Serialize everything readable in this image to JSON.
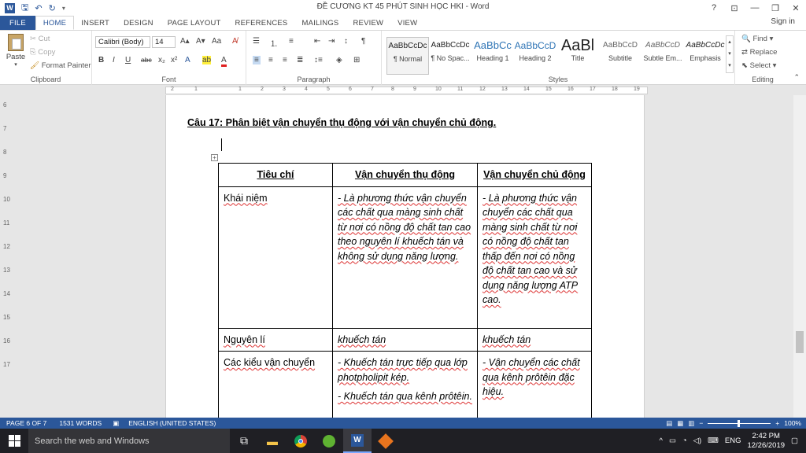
{
  "window": {
    "title": "ĐỀ CƯƠNG KT 45 PHÚT SINH HỌC HKI - Word",
    "controls": [
      "?",
      "⊡",
      "—",
      "❐",
      "✕"
    ]
  },
  "quick_access": {
    "app_icon": "W",
    "save_icon": "save-icon",
    "undo_icon": "undo-icon",
    "redo_icon": "redo-icon"
  },
  "tabs": [
    "FILE",
    "HOME",
    "INSERT",
    "DESIGN",
    "PAGE LAYOUT",
    "REFERENCES",
    "MAILINGS",
    "REVIEW",
    "VIEW"
  ],
  "active_tab": "HOME",
  "signin": "Sign in",
  "clipboard": {
    "paste": "Paste",
    "cut": "Cut",
    "copy": "Copy",
    "format_painter": "Format Painter",
    "label": "Clipboard"
  },
  "font": {
    "name": "Calibri (Body)",
    "size": "14",
    "label": "Font"
  },
  "paragraph": {
    "label": "Paragraph"
  },
  "styles": {
    "label": "Styles",
    "items": [
      {
        "preview": "AaBbCcDc",
        "name": "¶ Normal"
      },
      {
        "preview": "AaBbCcDc",
        "name": "¶ No Spac..."
      },
      {
        "preview": "AaBbCc",
        "name": "Heading 1"
      },
      {
        "preview": "AaBbCcD",
        "name": "Heading 2"
      },
      {
        "preview": "AaBl",
        "name": "Title"
      },
      {
        "preview": "AaBbCcD",
        "name": "Subtitle"
      },
      {
        "preview": "AaBbCcD",
        "name": "Subtle Em..."
      },
      {
        "preview": "AaBbCcDc",
        "name": "Emphasis"
      }
    ]
  },
  "editing": {
    "find": "Find",
    "replace": "Replace",
    "select": "Select",
    "label": "Editing"
  },
  "ruler": {
    "marks": [
      "2",
      "1",
      "1",
      "2",
      "3",
      "4",
      "5",
      "6",
      "7",
      "8",
      "9",
      "10",
      "11",
      "12",
      "13",
      "14",
      "15",
      "16",
      "17",
      "18",
      "19"
    ]
  },
  "vruler": {
    "marks": [
      "6",
      "7",
      "8",
      "9",
      "10",
      "11",
      "12",
      "13",
      "14",
      "15",
      "16",
      "17"
    ]
  },
  "document": {
    "question": "Câu 17: Phân biệt vận chuyển thụ động với vận chuyển chủ động.",
    "table": {
      "headers": [
        "Tiêu chí",
        "Vận chuyển thụ động",
        "Vận chuyển chủ động"
      ],
      "rows": [
        {
          "c1": "Khái niệm",
          "c2": "- Là phương thức vận chuyển các chất qua màng sinh chất từ nơi có nồng độ chất tan cao theo nguyên lí khuếch tán và không sử dụng năng lượng.",
          "c3": "- Là phương thức vận chuyển các chất qua màng sinh chất từ nơi có nồng độ chất tan thấp đến nơi có nồng độ chất tan cao và sử dụng năng lượng ATP cao."
        },
        {
          "c1": "Nguyên lí",
          "c2": "khuếch tán",
          "c3": "khuếch tán"
        },
        {
          "c1": "Các kiểu vận chuyển",
          "c2a": "- Khuếch tán trực tiếp qua lớp photpholipit kép.",
          "c2b": "- Khuếch tán qua kênh prôtêin.",
          "c3": "- Vận chuyển các chất qua kênh prôtêin đặc hiệu."
        }
      ]
    }
  },
  "status": {
    "page": "PAGE 6 OF 7",
    "words": "1531 WORDS",
    "language": "ENGLISH (UNITED STATES)",
    "zoom": "100%"
  },
  "taskbar": {
    "search_placeholder": "Search the web and Windows",
    "lang": "ENG",
    "time": "2:42 PM",
    "date": "12/26/2019"
  }
}
